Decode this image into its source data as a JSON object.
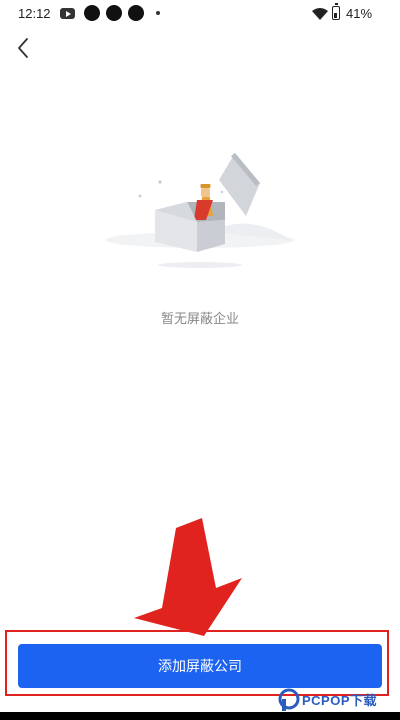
{
  "status_bar": {
    "time": "12:12",
    "battery": "41%"
  },
  "icons": {
    "back": "chevron-left-icon",
    "empty_state": "empty-box-illustration"
  },
  "empty_state": {
    "message": "暂无屏蔽企业"
  },
  "actions": {
    "add_button_label": "添加屏蔽公司"
  },
  "annotation": {
    "arrow_color": "#e0231e",
    "box_color": "#e0231e"
  },
  "watermark": {
    "text": "PCPOP下载"
  },
  "colors": {
    "primary": "#1d63f2",
    "text_muted": "#888888"
  }
}
